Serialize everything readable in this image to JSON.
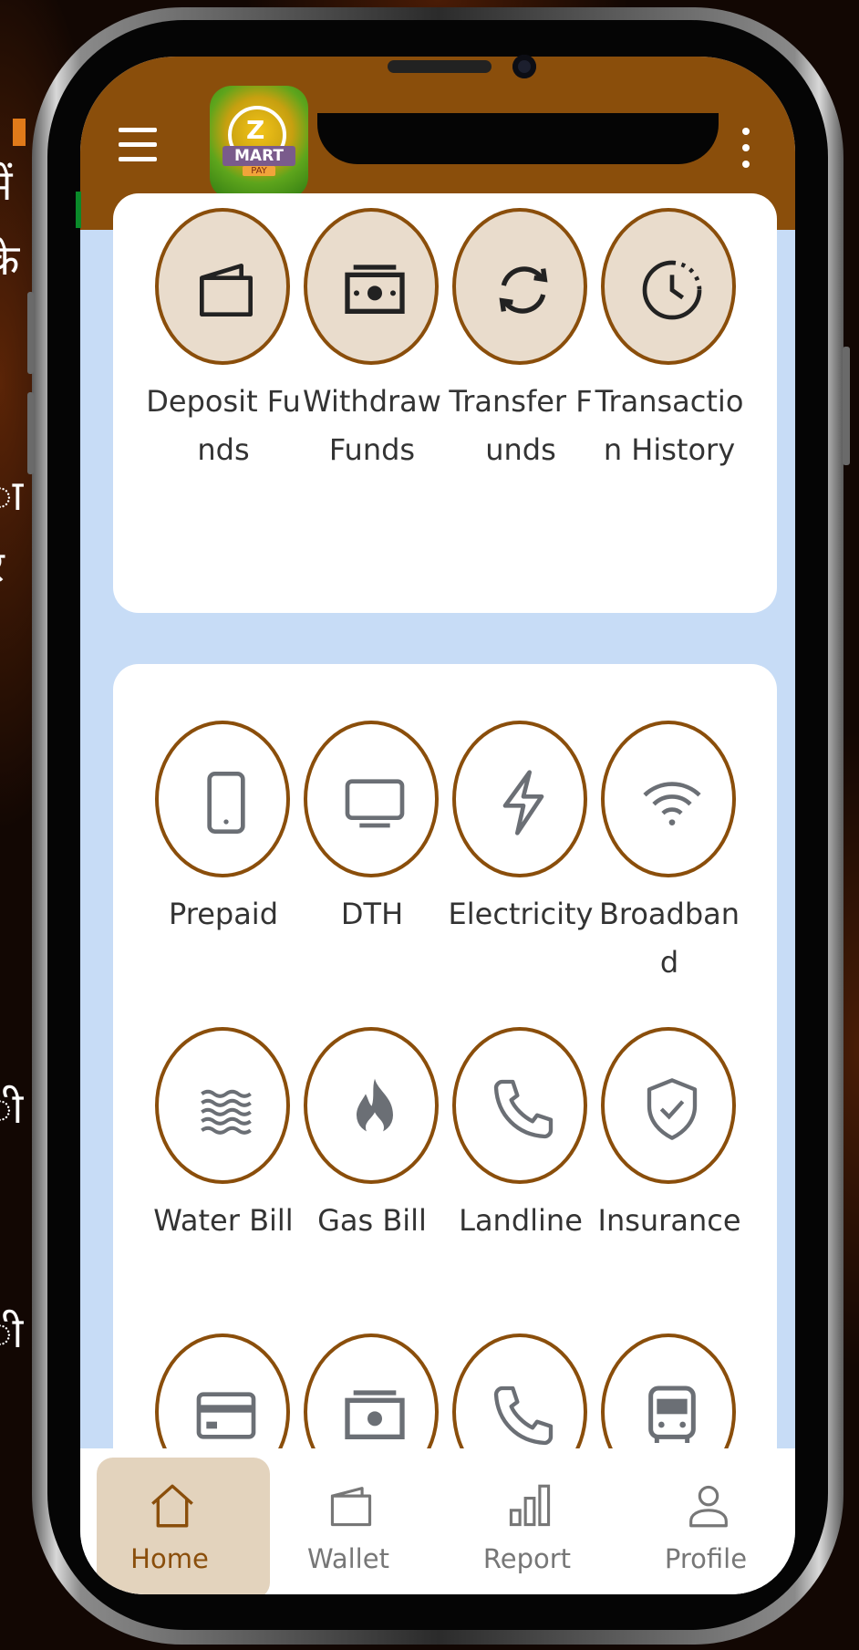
{
  "background_text": {
    "lines": [
      "में",
      "के",
      "ा",
      "र",
      ",",
      "।",
      "ी",
      "ी"
    ]
  },
  "header": {
    "logo_text": "MART",
    "logo_sub": "PAY",
    "logo_letter": "Z",
    "menu_icon": "hamburger-menu-icon",
    "more_icon": "vertical-dots-icon"
  },
  "wallet_section": {
    "tiles": [
      {
        "label": "Deposit Funds",
        "icon": "wallet-icon"
      },
      {
        "label": "Withdraw Funds",
        "icon": "banknote-icon"
      },
      {
        "label": "Transfer Funds",
        "icon": "refresh-arrows-icon"
      },
      {
        "label": "Transaction History",
        "icon": "clock-history-icon"
      }
    ]
  },
  "services_section": {
    "rows": [
      [
        {
          "label": "Prepaid",
          "icon": "smartphone-icon"
        },
        {
          "label": "DTH",
          "icon": "tv-icon"
        },
        {
          "label": "Electricity",
          "icon": "lightning-icon"
        },
        {
          "label": "Broadband",
          "icon": "wifi-icon"
        }
      ],
      [
        {
          "label": "Water Bill",
          "icon": "water-waves-icon"
        },
        {
          "label": "Gas Bill",
          "icon": "flame-icon"
        },
        {
          "label": "Landline",
          "icon": "phone-icon"
        },
        {
          "label": "Insurance",
          "icon": "shield-check-icon"
        }
      ],
      [
        {
          "label": "",
          "icon": "credit-card-icon"
        },
        {
          "label": "",
          "icon": "banknote-icon"
        },
        {
          "label": "",
          "icon": "phone-icon"
        },
        {
          "label": "",
          "icon": "bus-icon"
        }
      ]
    ]
  },
  "bottom_nav": {
    "items": [
      {
        "label": "Home",
        "icon": "home-icon",
        "active": true
      },
      {
        "label": "Wallet",
        "icon": "wallet-icon",
        "active": false
      },
      {
        "label": "Report",
        "icon": "bar-chart-icon",
        "active": false
      },
      {
        "label": "Profile",
        "icon": "user-icon",
        "active": false
      }
    ]
  },
  "colors": {
    "brand_brown": "#8a4e0b",
    "screen_bg": "#c7dcf6",
    "tile_tan": "#e9dccc",
    "nav_active_bg": "#e3d3bd",
    "icon_gray": "#6b6f75"
  }
}
